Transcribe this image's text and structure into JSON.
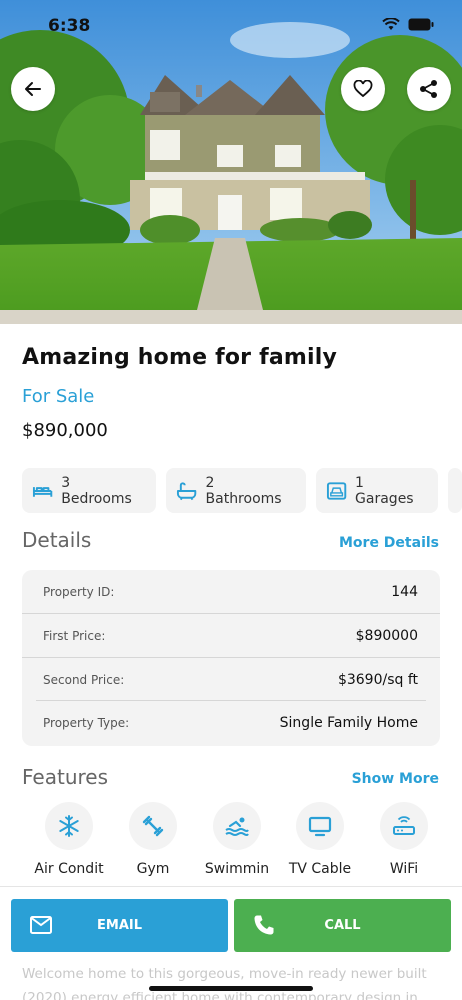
{
  "status_bar": {
    "time": "6:38"
  },
  "listing": {
    "title": "Amazing home for family",
    "status": "For Sale",
    "price": "$890,000"
  },
  "chips": [
    {
      "icon": "bed-icon",
      "label": "3 Bedrooms"
    },
    {
      "icon": "bathtub-icon",
      "label": "2 Bathrooms"
    },
    {
      "icon": "car-icon",
      "label": "1 Garages"
    }
  ],
  "details": {
    "title": "Details",
    "more_label": "More Details",
    "rows": [
      {
        "key": "Property ID:",
        "value": "144"
      },
      {
        "key": "First Price:",
        "value": "$890000"
      },
      {
        "key": "Second Price:",
        "value": "$3690/sq ft"
      },
      {
        "key": "Property Type:",
        "value": "Single Family Home"
      }
    ]
  },
  "features": {
    "title": "Features",
    "more_label": "Show More",
    "items": [
      {
        "icon": "snowflake-icon",
        "label": "Air Condit"
      },
      {
        "icon": "dumbbell-icon",
        "label": "Gym"
      },
      {
        "icon": "swimming-icon",
        "label": "Swimmin"
      },
      {
        "icon": "tv-icon",
        "label": "TV Cable"
      },
      {
        "icon": "router-icon",
        "label": "WiFi"
      }
    ]
  },
  "actions": {
    "email_label": "EMAIL",
    "call_label": "CALL"
  },
  "description": "Welcome home to this gorgeous, move-in ready newer built (2020) energy efficient home with contemporary design in",
  "colors": {
    "accent": "#2aa0d6",
    "call": "#4caf50",
    "card_bg": "#f3f3f3"
  }
}
